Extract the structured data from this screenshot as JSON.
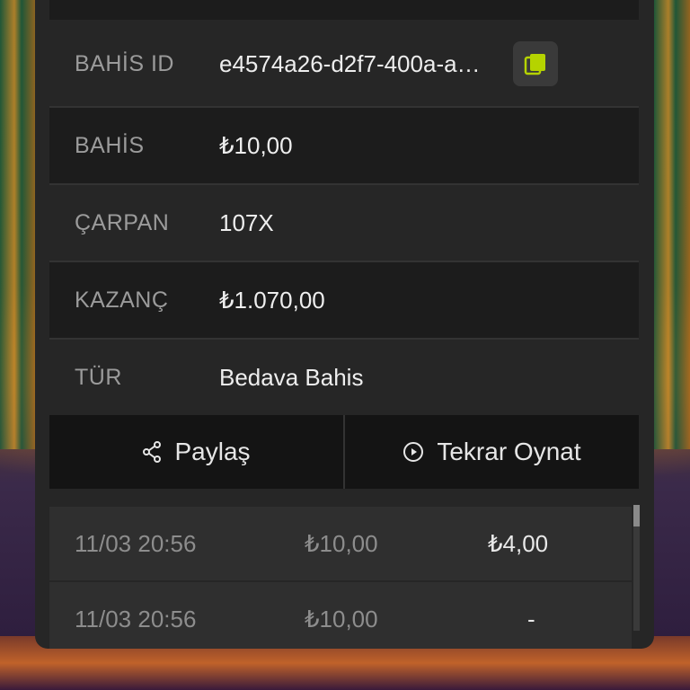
{
  "details": {
    "bet_id": {
      "label": "BAHİS ID",
      "value": "e4574a26-d2f7-400a-a…"
    },
    "bet": {
      "label": "BAHİS",
      "value": "₺10,00"
    },
    "multiplier": {
      "label": "ÇARPAN",
      "value": "107X"
    },
    "win": {
      "label": "KAZANÇ",
      "value": "₺1.070,00"
    },
    "type": {
      "label": "TÜR",
      "value": "Bedava Bahis"
    }
  },
  "actions": {
    "share_label": "Paylaş",
    "replay_label": "Tekrar Oynat"
  },
  "history": [
    {
      "time": "11/03 20:56",
      "bet": "₺10,00",
      "win": "₺4,00"
    },
    {
      "time": "11/03 20:56",
      "bet": "₺10,00",
      "win": "-"
    }
  ],
  "colors": {
    "panel": "#262626",
    "row_dark": "#1c1c1c",
    "copy_accent": "#b5d300"
  },
  "icons": [
    "copy-icon",
    "share-icon",
    "play-circle-icon"
  ]
}
